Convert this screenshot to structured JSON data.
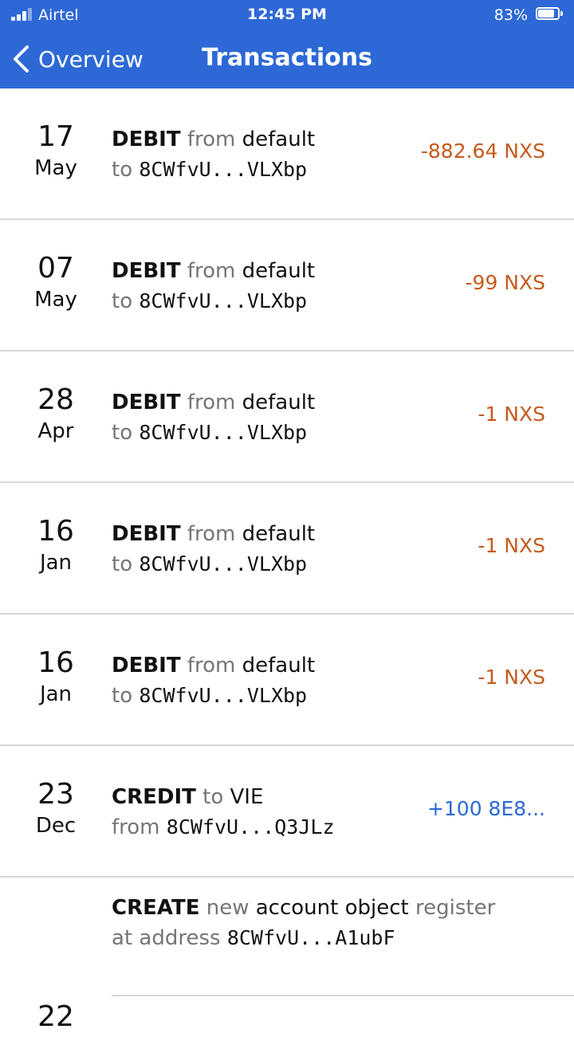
{
  "status_bar": {
    "carrier": "Airtel",
    "time": "12:45 PM",
    "battery": "83%"
  },
  "nav": {
    "back_label": "Overview",
    "title": "Transactions"
  },
  "transactions": [
    {
      "day": "17",
      "month": "May",
      "op": "DEBIT",
      "w1": "from",
      "w2": "default",
      "w3": "to",
      "addr": "8CWfvU...VLXbp",
      "amount": "-882.64 NXS"
    },
    {
      "day": "07",
      "month": "May",
      "op": "DEBIT",
      "w1": "from",
      "w2": "default",
      "w3": "to",
      "addr": "8CWfvU...VLXbp",
      "amount": "-99 NXS"
    },
    {
      "day": "28",
      "month": "Apr",
      "op": "DEBIT",
      "w1": "from",
      "w2": "default",
      "w3": "to",
      "addr": "8CWfvU...VLXbp",
      "amount": "-1 NXS"
    },
    {
      "day": "16",
      "month": "Jan",
      "op": "DEBIT",
      "w1": "from",
      "w2": "default",
      "w3": "to",
      "addr": "8CWfvU...VLXbp",
      "amount": "-1 NXS"
    },
    {
      "day": "16",
      "month": "Jan",
      "op": "DEBIT",
      "w1": "from",
      "w2": "default",
      "w3": "to",
      "addr": "8CWfvU...VLXbp",
      "amount": "-1 NXS"
    },
    {
      "day": "23",
      "month": "Dec",
      "op": "CREDIT",
      "w1": "to",
      "w2": "VIE",
      "w3": "from",
      "addr": "8CWfvU...Q3JLz",
      "amount": "+100 8E8..."
    },
    {
      "op": "CREATE",
      "w1": "new",
      "w2": "account object",
      "w4": "register",
      "w3": "at address",
      "addr": "8CWfvU...A1ubF"
    }
  ],
  "partial_next_day": "22",
  "colors": {
    "header": "#2d68d6",
    "debit": "#c55a1c",
    "credit": "#2d68d6",
    "separator": "#d8d8d8"
  }
}
